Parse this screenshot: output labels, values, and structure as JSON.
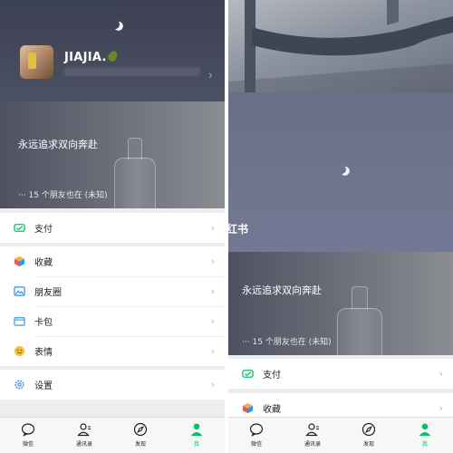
{
  "profile": {
    "nickname": "JIAJIA.",
    "nickname_emoji": "avocado-emoji",
    "wechat_id_blurred": true
  },
  "status": {
    "text": "永远追求双向奔赴",
    "friends_prefix": "···",
    "friends_text": "15 个朋友也在 (未知)"
  },
  "watermark": {
    "text": "红书"
  },
  "menu": {
    "pay": {
      "label": "支付",
      "icon": "pay-icon"
    },
    "favorites": {
      "label": "收藏",
      "icon": "favorites-cube-icon"
    },
    "moments": {
      "label": "朋友圈",
      "icon": "moments-photo-icon"
    },
    "cards": {
      "label": "卡包",
      "icon": "card-wallet-icon"
    },
    "stickers": {
      "label": "表情",
      "icon": "sticker-smile-icon"
    },
    "settings": {
      "label": "设置",
      "icon": "gear-icon"
    }
  },
  "tabbar": {
    "chats": "微信",
    "contacts": "通讯录",
    "discover": "发现",
    "me": "我",
    "active": "me"
  },
  "colors": {
    "accent_green": "#07c160",
    "header_dark": "#3c4152",
    "night_sky": "#6e7390",
    "favorites_cube": "#2e9be6",
    "moments_blue": "#2c8fe0",
    "cards_blue": "#35a0e8",
    "sticker_yellow": "#f5c242",
    "settings_blue": "#2e8fe0"
  }
}
